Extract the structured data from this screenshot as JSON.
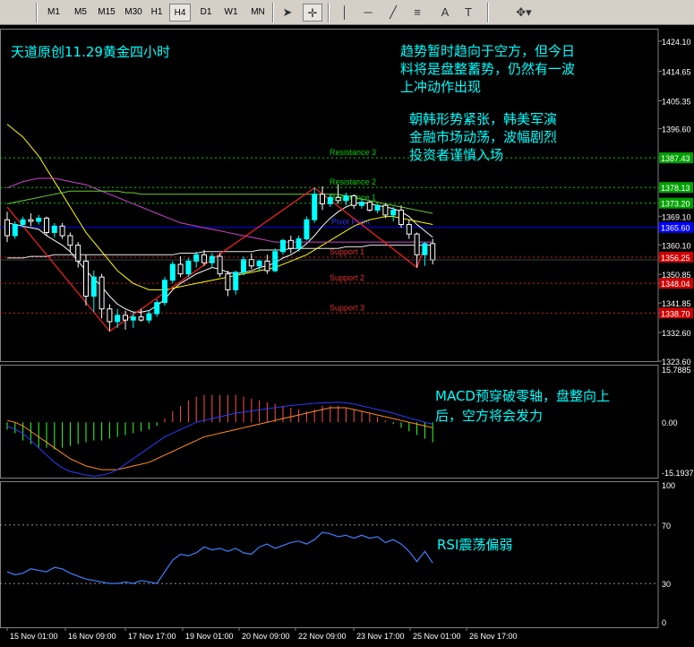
{
  "toolbar": {
    "timeframes": [
      "M1",
      "M5",
      "M15",
      "M30",
      "H1",
      "H4",
      "D1",
      "W1",
      "MN"
    ],
    "active_timeframe": "H4",
    "tools": [
      {
        "icon": "cursor-arrow-icon",
        "glyph": "➤"
      },
      {
        "icon": "crosshair-icon",
        "glyph": "✛"
      },
      {
        "icon": "vertical-line-icon",
        "glyph": "│"
      },
      {
        "icon": "horizontal-line-icon",
        "glyph": "─"
      },
      {
        "icon": "trendline-icon",
        "glyph": "╱"
      },
      {
        "icon": "fibonacci-icon",
        "glyph": "≡"
      },
      {
        "icon": "text-icon",
        "glyph": "A"
      },
      {
        "icon": "text-label-icon",
        "glyph": "T"
      },
      {
        "icon": "arrows-dropdown-icon",
        "glyph": "✥▾"
      }
    ]
  },
  "annotations": {
    "title": "天道原创11.29黄金四小时",
    "trend_comment": [
      "趋势暂时趋向于空方，但今日",
      "料将是盘整蓄势，仍然有一波",
      "上冲动作出现"
    ],
    "news_comment": [
      "朝韩形势紧张，韩美军演",
      "金融市场动荡，波幅剧烈",
      "投资者谨慎入场"
    ],
    "macd_comment": [
      "MACD预穿破零轴，盘整向上",
      "后，空方将会发力"
    ],
    "rsi_comment": [
      "RSI震荡偏弱"
    ]
  },
  "colors": {
    "background": "#000000",
    "grid": "#808080",
    "bull": "#00ffff",
    "bear": "#ffffff",
    "resistance": "#00ff00",
    "support": "#ff2020",
    "pivot": "#0000ff",
    "macd_pos": "#ff4d4d",
    "macd_neg": "#33ff33",
    "rsi": "#3f7fff",
    "text_cn": "#00ffff"
  },
  "chart_data": [
    {
      "type": "candlestick",
      "name_visible": false,
      "y_axis_labels": [
        "1424.10",
        "1414.65",
        "1405.35",
        "1396.60",
        "1387.43",
        "1378.13",
        "1373.20",
        "1369.10",
        "1365.60",
        "1360.10",
        "1356.25",
        "1350.85",
        "1348.04",
        "1341.85",
        "1338.70",
        "1332.60",
        "1323.60"
      ],
      "ylim": [
        1323.6,
        1428
      ],
      "current_price": 1355.4,
      "ohlc": [
        [
          1368.0,
          1370.5,
          1361.0,
          1363.0
        ],
        [
          1363.0,
          1367.5,
          1362.0,
          1366.5
        ],
        [
          1366.5,
          1369.0,
          1365.5,
          1368.0
        ],
        [
          1368.0,
          1370.0,
          1366.0,
          1367.5
        ],
        [
          1367.5,
          1369.5,
          1366.5,
          1368.5
        ],
        [
          1368.5,
          1369.0,
          1363.0,
          1364.0
        ],
        [
          1364.0,
          1367.0,
          1362.5,
          1366.0
        ],
        [
          1366.0,
          1367.0,
          1362.0,
          1363.0
        ],
        [
          1363.0,
          1364.0,
          1358.0,
          1360.0
        ],
        [
          1360.0,
          1361.0,
          1353.0,
          1355.0
        ],
        [
          1355.0,
          1357.0,
          1341.0,
          1344.0
        ],
        [
          1344.0,
          1352.0,
          1339.0,
          1350.0
        ],
        [
          1350.0,
          1351.0,
          1337.0,
          1340.0
        ],
        [
          1340.0,
          1341.5,
          1333.0,
          1336.0
        ],
        [
          1336.0,
          1340.0,
          1334.0,
          1338.0
        ],
        [
          1338.0,
          1339.5,
          1333.5,
          1336.5
        ],
        [
          1336.5,
          1339.0,
          1334.0,
          1337.5
        ],
        [
          1337.5,
          1340.0,
          1336.0,
          1336.5
        ],
        [
          1336.5,
          1339.5,
          1335.5,
          1338.5
        ],
        [
          1338.5,
          1343.0,
          1337.5,
          1342.0
        ],
        [
          1342.0,
          1350.0,
          1341.0,
          1349.0
        ],
        [
          1349.0,
          1355.0,
          1348.0,
          1354.0
        ],
        [
          1354.0,
          1356.5,
          1350.0,
          1351.0
        ],
        [
          1351.0,
          1356.0,
          1350.0,
          1355.0
        ],
        [
          1355.0,
          1358.0,
          1353.0,
          1357.0
        ],
        [
          1357.0,
          1358.5,
          1353.5,
          1354.5
        ],
        [
          1354.5,
          1357.5,
          1353.0,
          1356.5
        ],
        [
          1356.5,
          1357.5,
          1350.0,
          1351.0
        ],
        [
          1351.0,
          1352.0,
          1344.0,
          1346.0
        ],
        [
          1346.0,
          1352.0,
          1344.5,
          1351.5
        ],
        [
          1351.5,
          1356.5,
          1350.5,
          1355.5
        ],
        [
          1355.5,
          1357.5,
          1352.5,
          1353.5
        ],
        [
          1353.5,
          1355.5,
          1352.0,
          1355.0
        ],
        [
          1355.0,
          1357.0,
          1351.0,
          1352.0
        ],
        [
          1352.0,
          1359.0,
          1351.5,
          1358.0
        ],
        [
          1358.0,
          1362.0,
          1357.0,
          1361.5
        ],
        [
          1361.5,
          1363.0,
          1357.5,
          1359.0
        ],
        [
          1359.0,
          1363.0,
          1358.0,
          1362.0
        ],
        [
          1362.0,
          1369.0,
          1361.5,
          1368.0
        ],
        [
          1368.0,
          1378.0,
          1367.0,
          1376.0
        ],
        [
          1376.0,
          1378.5,
          1371.0,
          1373.0
        ],
        [
          1373.0,
          1376.0,
          1372.0,
          1375.0
        ],
        [
          1375.0,
          1379.0,
          1373.0,
          1374.0
        ],
        [
          1374.0,
          1376.5,
          1372.5,
          1375.5
        ],
        [
          1375.5,
          1376.0,
          1371.5,
          1372.5
        ],
        [
          1372.5,
          1374.5,
          1371.5,
          1373.5
        ],
        [
          1373.5,
          1374.0,
          1370.5,
          1371.0
        ],
        [
          1371.0,
          1373.0,
          1370.0,
          1372.5
        ],
        [
          1372.5,
          1373.0,
          1368.5,
          1369.5
        ],
        [
          1369.5,
          1372.0,
          1367.5,
          1371.0
        ],
        [
          1371.0,
          1372.5,
          1365.5,
          1366.5
        ],
        [
          1366.5,
          1368.0,
          1362.0,
          1363.5
        ],
        [
          1363.5,
          1364.0,
          1353.0,
          1357.0
        ],
        [
          1357.0,
          1361.0,
          1353.5,
          1360.5
        ],
        [
          1360.5,
          1362.0,
          1354.0,
          1355.4
        ]
      ],
      "moving_averages": [
        {
          "color": "#ffffff",
          "values": [
            1367,
            1366.5,
            1366,
            1365.5,
            1365,
            1363,
            1361.5,
            1360,
            1358,
            1355,
            1352,
            1349.5,
            1347,
            1344,
            1341.5,
            1340,
            1339,
            1339,
            1339.5,
            1341,
            1343,
            1346,
            1348,
            1349.5,
            1351,
            1352,
            1353,
            1352.5,
            1351.5,
            1351,
            1351.5,
            1352,
            1353,
            1353.5,
            1354.5,
            1356,
            1357,
            1358.5,
            1360.5,
            1363,
            1366,
            1368.5,
            1370.5,
            1372,
            1373,
            1373.5,
            1373,
            1372.5,
            1372,
            1371.5,
            1370.5,
            1369,
            1366.5,
            1364.5,
            1362.5
          ]
        },
        {
          "color": "#ffff00",
          "values": [
            1398,
            1396,
            1394,
            1391,
            1388,
            1384,
            1380,
            1376,
            1372,
            1368,
            1364,
            1361,
            1358,
            1355,
            1352,
            1350,
            1348,
            1347,
            1346,
            1346,
            1346,
            1346.5,
            1347,
            1347.5,
            1348,
            1348.5,
            1349,
            1349.5,
            1350,
            1350.5,
            1351,
            1351.5,
            1352,
            1352.5,
            1353,
            1354,
            1355,
            1356,
            1357,
            1358.5,
            1360,
            1361.5,
            1363,
            1364.5,
            1366,
            1367,
            1368,
            1368.5,
            1369,
            1369,
            1368.5,
            1368,
            1367.5,
            1367,
            1366.5
          ]
        },
        {
          "color": "#cc44cc",
          "values": [
            1378,
            1379,
            1380,
            1380.5,
            1381,
            1381,
            1381,
            1380.5,
            1380,
            1379.5,
            1379,
            1378,
            1377,
            1376,
            1375,
            1374,
            1373,
            1372,
            1371,
            1370,
            1369,
            1368,
            1367,
            1366.5,
            1366,
            1365.5,
            1365,
            1364.5,
            1364,
            1363.5,
            1363,
            1362.5,
            1362,
            1361.5,
            1361,
            1361,
            1361,
            1361,
            1361,
            1361,
            1361,
            1361,
            1361,
            1361,
            1361,
            1361,
            1361,
            1361,
            1361,
            1361,
            1361,
            1361,
            1361,
            1361,
            1361
          ]
        },
        {
          "color": "#66cc33",
          "values": [
            1373,
            1373.5,
            1374,
            1374.5,
            1375,
            1375.5,
            1376,
            1376.5,
            1377,
            1377,
            1377,
            1377,
            1377,
            1377,
            1377,
            1376.5,
            1376.5,
            1376,
            1376,
            1376,
            1376,
            1376,
            1376,
            1376,
            1376,
            1376,
            1376,
            1376,
            1376,
            1376,
            1376,
            1376,
            1376,
            1376,
            1376,
            1376,
            1376,
            1376,
            1376,
            1376,
            1376,
            1376,
            1376,
            1375.5,
            1375,
            1374.5,
            1374,
            1373.5,
            1373,
            1372.5,
            1372,
            1371.5,
            1371,
            1370.5,
            1370
          ]
        },
        {
          "color": "#e8e8e8",
          "values": [
            1356,
            1356,
            1356,
            1356.5,
            1356.5,
            1356.5,
            1357,
            1357,
            1357,
            1357,
            1357,
            1357,
            1357,
            1357,
            1357,
            1357,
            1357,
            1357,
            1357,
            1357,
            1357,
            1357,
            1357.5,
            1357.5,
            1357.5,
            1358,
            1358,
            1358,
            1358,
            1358,
            1358,
            1358,
            1358.5,
            1358.5,
            1358.5,
            1358.5,
            1359,
            1359,
            1359,
            1359,
            1359,
            1359,
            1359,
            1359.5,
            1359.5,
            1359.5,
            1360,
            1360,
            1360,
            1360,
            1360,
            1360,
            1360,
            1360,
            1360
          ]
        }
      ],
      "zigzag": [
        [
          0,
          1372
        ],
        [
          13,
          1333
        ],
        [
          39,
          1378
        ],
        [
          52,
          1353
        ],
        [
          53,
          1360
        ]
      ],
      "levels": [
        {
          "label": "Resistance 3",
          "value": 1387.43,
          "kind": "resistance",
          "price_tag": "1387.43"
        },
        {
          "label": "Resistance 2",
          "value": 1378.13,
          "kind": "resistance",
          "price_tag": "1378.13"
        },
        {
          "label": "Resistance 1",
          "value": 1373.2,
          "kind": "resistance",
          "price_tag": "1373.20"
        },
        {
          "label": "Pivot Point",
          "value": 1365.6,
          "kind": "pivot",
          "price_tag": "1365.60"
        },
        {
          "label": "Support 1",
          "value": 1356.25,
          "kind": "support",
          "price_tag": "1356.25"
        },
        {
          "label": "Support 2",
          "value": 1348.04,
          "kind": "support",
          "price_tag": "1348.04"
        },
        {
          "label": "Support 3",
          "value": 1338.7,
          "kind": "support",
          "price_tag": "1338.70"
        }
      ]
    },
    {
      "type": "histogram",
      "indicator": "MACD",
      "y_axis_labels": [
        "15.7885",
        "0.00",
        "-15.1937"
      ],
      "ylim": [
        -15.1937,
        15.7885
      ],
      "values": [
        -2,
        -3,
        -5,
        -6,
        -7,
        -7,
        -7.5,
        -7,
        -6.5,
        -6,
        -5.5,
        -5,
        -5,
        -4.5,
        -4,
        -3.5,
        -3,
        -2.5,
        -2,
        -1,
        1,
        3,
        4.5,
        6,
        7,
        7.5,
        7.5,
        7.5,
        7.5,
        7.5,
        7,
        6.5,
        6,
        5.5,
        5,
        4.5,
        4,
        3.5,
        3,
        3.5,
        4.5,
        4.5,
        4.5,
        4,
        3.5,
        3,
        2.5,
        1.5,
        0.5,
        -0.5,
        -1.5,
        -2.5,
        -3.5,
        -4.5,
        -5.5
      ],
      "signal_line": [
        0.5,
        0,
        -1,
        -2.5,
        -4,
        -5.5,
        -7,
        -8.5,
        -10,
        -11,
        -12,
        -12.5,
        -13,
        -13,
        -13,
        -12.5,
        -12,
        -11.5,
        -11,
        -10,
        -9,
        -8,
        -7,
        -6,
        -5,
        -4,
        -3.5,
        -3,
        -2.5,
        -2,
        -1.5,
        -1,
        -0.5,
        0,
        0.5,
        1,
        1.5,
        2,
        2.5,
        3,
        3.5,
        4,
        4,
        4,
        3.5,
        3,
        2.5,
        2,
        1.5,
        1,
        0.5,
        0,
        -0.5,
        -1,
        -1.5
      ],
      "macd_line": [
        -1,
        -2,
        -3,
        -5,
        -7,
        -9,
        -11,
        -12.5,
        -13.5,
        -14,
        -14.5,
        -14.8,
        -14.5,
        -14,
        -13,
        -11.5,
        -10,
        -8.5,
        -7,
        -5.5,
        -4,
        -3,
        -2,
        -1,
        0,
        0.5,
        1,
        1.5,
        2,
        2.5,
        2.8,
        3.1,
        3.4,
        3.7,
        4,
        4.3,
        4.6,
        4.8,
        5,
        5.2,
        5.3,
        5.4,
        5.5,
        5.3,
        5,
        4.5,
        4,
        3.5,
        3,
        2.5,
        1.8,
        1.2,
        0.6,
        0,
        -0.5
      ]
    },
    {
      "type": "line",
      "indicator": "RSI",
      "y_axis_labels": [
        "100",
        "70",
        "30",
        "0"
      ],
      "ylim": [
        0,
        100
      ],
      "levels": [
        70,
        30
      ],
      "values": [
        38,
        36,
        37,
        40,
        39,
        38,
        41,
        40,
        37,
        35,
        33,
        32,
        31,
        30,
        30,
        31,
        30,
        32,
        31,
        30,
        38,
        46,
        50,
        49,
        51,
        55,
        53,
        54,
        52,
        54,
        51,
        50,
        55,
        57,
        54,
        56,
        58,
        59,
        57,
        60,
        65,
        64,
        62,
        63,
        61,
        63,
        61,
        62,
        58,
        60,
        57,
        52,
        45,
        52,
        44
      ]
    }
  ],
  "x_axis_labels": [
    "15 Nov 01:00",
    "16 Nov 09:00",
    "17 Nov 17:00",
    "19 Nov 01:00",
    "20 Nov 09:00",
    "22 Nov 09:00",
    "23 Nov 17:00",
    "25 Nov 01:00",
    "26 Nov 17:00"
  ]
}
